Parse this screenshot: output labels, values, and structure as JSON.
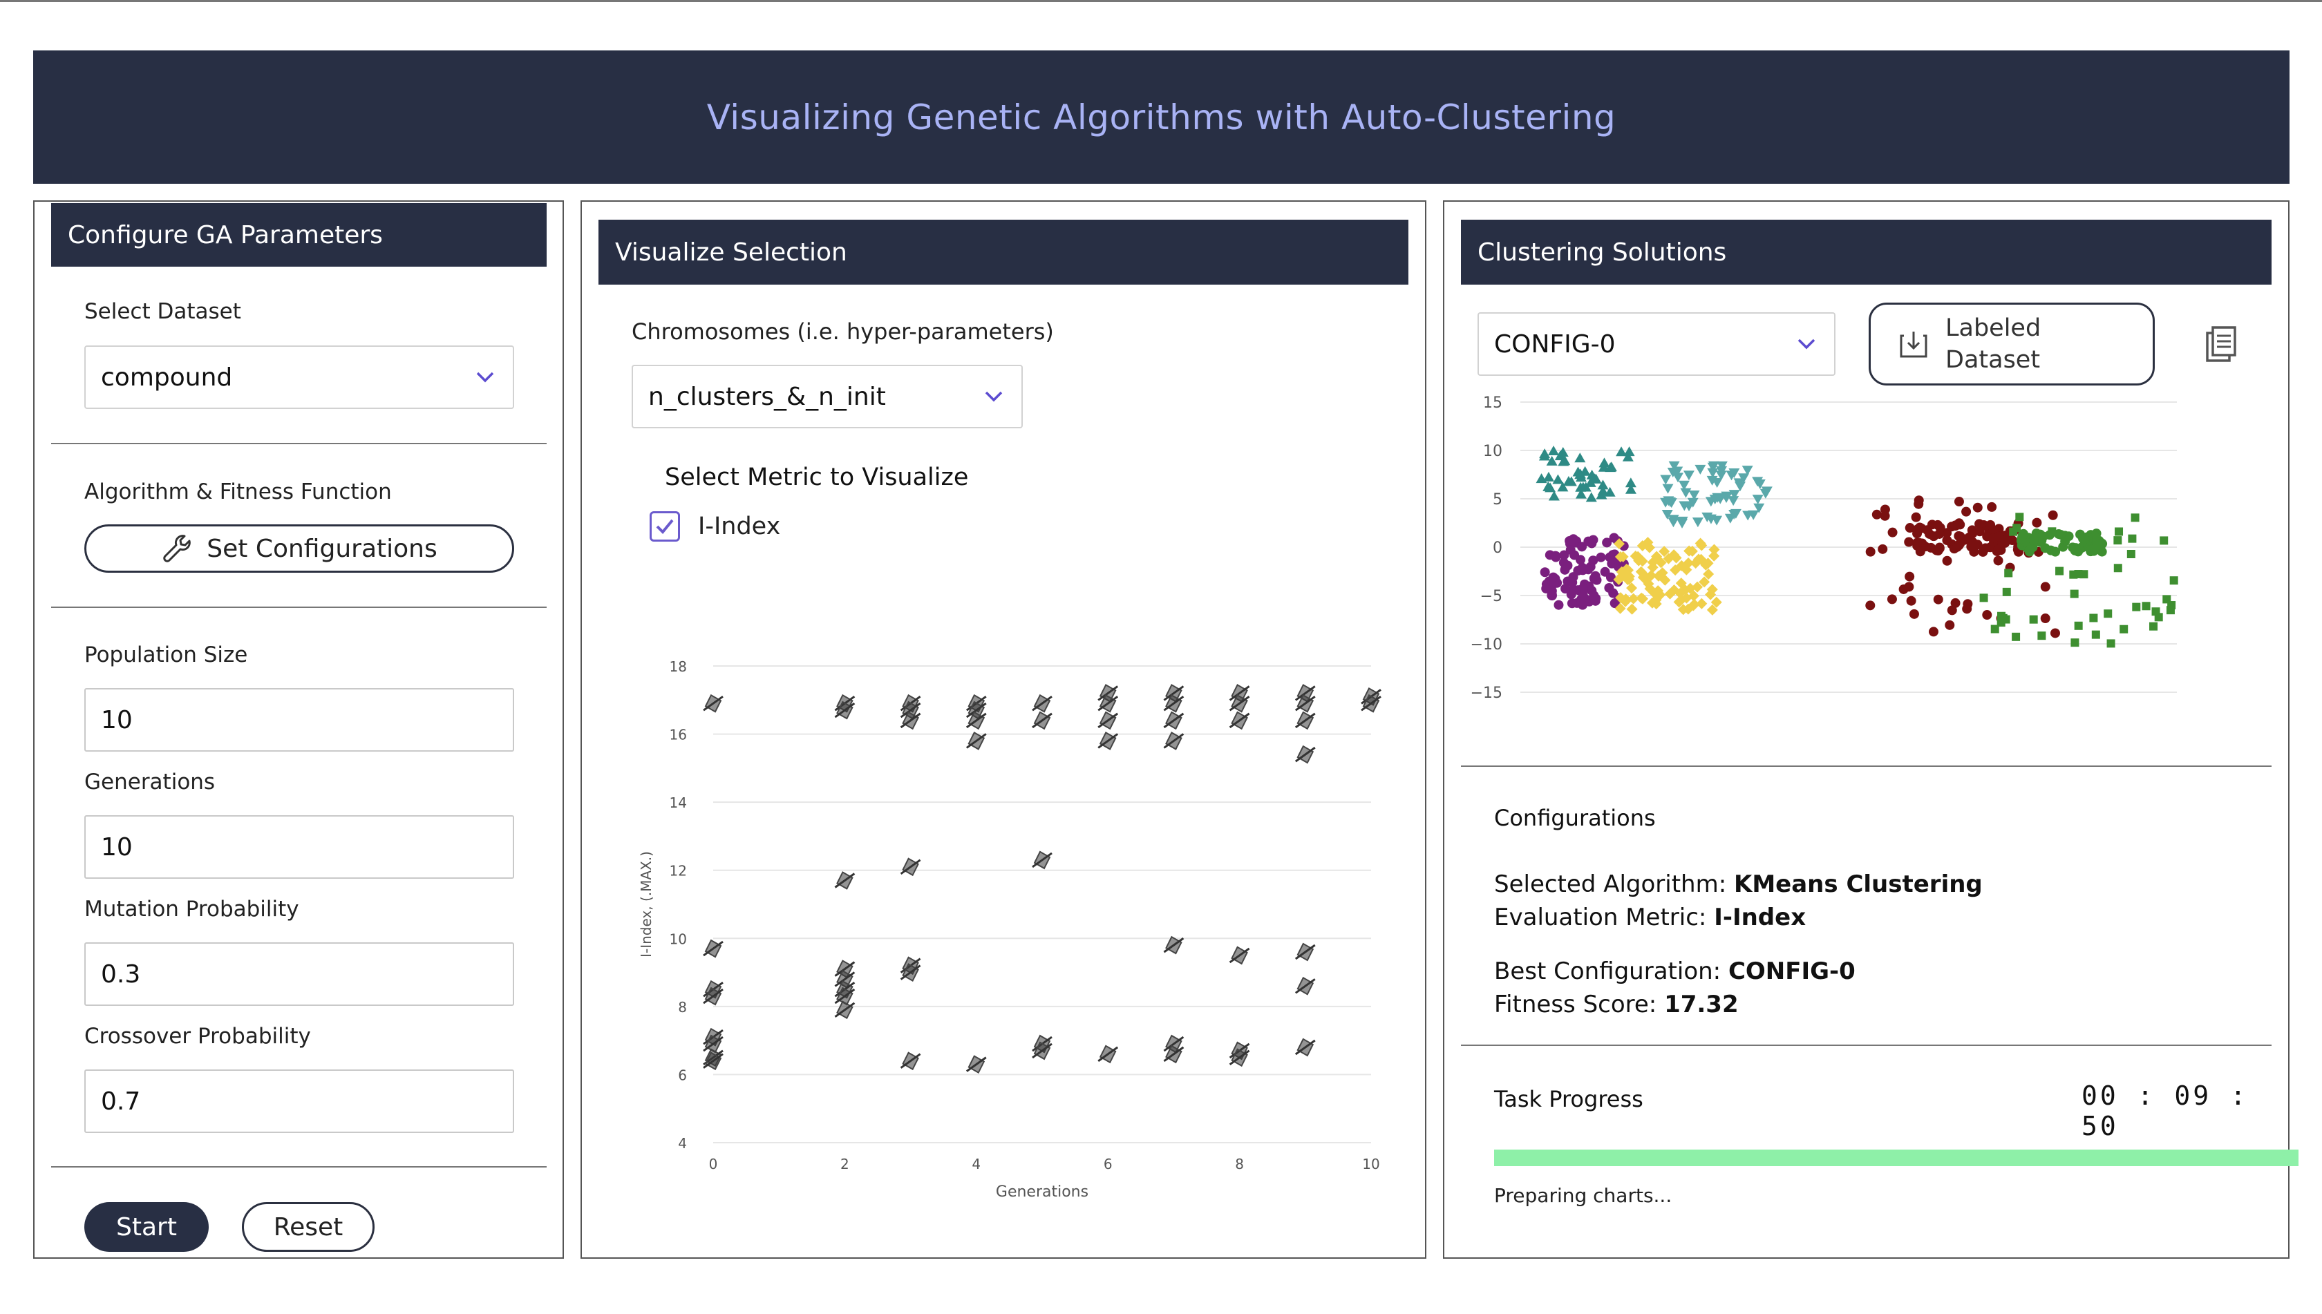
{
  "header": {
    "title": "Visualizing Genetic Algorithms with Auto-Clustering"
  },
  "left": {
    "title": "Configure GA Parameters",
    "dataset_label": "Select Dataset",
    "dataset_value": "compound",
    "algo_label": "Algorithm & Fitness Function",
    "set_config_label": "Set Configurations",
    "population_label": "Population Size",
    "population_value": "10",
    "generations_label": "Generations",
    "generations_value": "10",
    "mutation_label": "Mutation Probability",
    "mutation_value": "0.3",
    "crossover_label": "Crossover Probability",
    "crossover_value": "0.7",
    "start_label": "Start",
    "reset_label": "Reset"
  },
  "middle": {
    "title": "Visualize Selection",
    "chromosome_label": "Chromosomes (i.e. hyper-parameters)",
    "chromosome_value": "n_clusters_&_n_init",
    "metric_label": "Select Metric to Visualize",
    "metric_option": "I-Index",
    "metric_checked": true
  },
  "right": {
    "title": "Clustering Solutions",
    "config_value": "CONFIG-0",
    "labeled_line1": "Labeled",
    "labeled_line2": "Dataset",
    "configs_title": "Configurations",
    "algo_key": "Selected Algorithm:",
    "algo_val": "KMeans Clustering",
    "metric_key": "Evaluation Metric:",
    "metric_val": "I-Index",
    "best_key": "Best Configuration:",
    "best_val": "CONFIG-0",
    "fitness_key": "Fitness Score:",
    "fitness_val": "17.32",
    "progress_title": "Task Progress",
    "timer": "00 : 09 : 50",
    "progress_fraction": 1.0,
    "progress_color": "#8ef0a8",
    "status": "Preparing charts..."
  },
  "chart_data": [
    {
      "type": "scatter",
      "title": "",
      "xlabel": "Generations",
      "ylabel": "I-Index, (.MAX.)",
      "xlim": [
        0,
        10
      ],
      "ylim": [
        4,
        18
      ],
      "xticks": [
        "0",
        "2",
        "4",
        "6",
        "8",
        "10"
      ],
      "yticks": [
        "4",
        "6",
        "8",
        "10",
        "12",
        "14",
        "16",
        "18"
      ],
      "grid": true,
      "points": [
        [
          0,
          16.9
        ],
        [
          0,
          9.7
        ],
        [
          0,
          8.5
        ],
        [
          0,
          8.3
        ],
        [
          0,
          7.1
        ],
        [
          0,
          6.9
        ],
        [
          0,
          6.5
        ],
        [
          0,
          6.4
        ],
        [
          2,
          16.9
        ],
        [
          2,
          16.7
        ],
        [
          2,
          11.7
        ],
        [
          2,
          9.1
        ],
        [
          2,
          8.8
        ],
        [
          2,
          8.5
        ],
        [
          2,
          8.3
        ],
        [
          2,
          7.9
        ],
        [
          3,
          16.9
        ],
        [
          3,
          16.7
        ],
        [
          3,
          16.4
        ],
        [
          3,
          12.1
        ],
        [
          3,
          9.2
        ],
        [
          3,
          9.0
        ],
        [
          3,
          6.4
        ],
        [
          4,
          16.9
        ],
        [
          4,
          16.7
        ],
        [
          4,
          16.4
        ],
        [
          4,
          15.8
        ],
        [
          4,
          6.3
        ],
        [
          5,
          16.9
        ],
        [
          5,
          16.4
        ],
        [
          5,
          12.3
        ],
        [
          5,
          6.9
        ],
        [
          5,
          6.7
        ],
        [
          6,
          17.2
        ],
        [
          6,
          16.9
        ],
        [
          6,
          16.4
        ],
        [
          6,
          15.8
        ],
        [
          6,
          6.6
        ],
        [
          7,
          17.2
        ],
        [
          7,
          16.9
        ],
        [
          7,
          16.4
        ],
        [
          7,
          15.8
        ],
        [
          7,
          9.8
        ],
        [
          7,
          6.9
        ],
        [
          7,
          6.6
        ],
        [
          8,
          17.2
        ],
        [
          8,
          16.9
        ],
        [
          8,
          16.4
        ],
        [
          8,
          9.5
        ],
        [
          8,
          6.7
        ],
        [
          8,
          6.5
        ],
        [
          9,
          17.2
        ],
        [
          9,
          16.9
        ],
        [
          9,
          16.4
        ],
        [
          9,
          15.4
        ],
        [
          9,
          9.6
        ],
        [
          9,
          8.6
        ],
        [
          9,
          6.8
        ],
        [
          10,
          17.1
        ],
        [
          10,
          16.9
        ]
      ]
    },
    {
      "type": "scatter",
      "title": "",
      "xlabel": "",
      "ylabel": "",
      "yticks": [
        "15",
        "10",
        "5",
        "0",
        "−5",
        "−10",
        "−15"
      ],
      "ylim": [
        -15,
        15
      ],
      "xlim": [
        0,
        40
      ],
      "grid": true,
      "series": [
        {
          "marker": "triangle-up",
          "color": "#2e8a85",
          "center": [
            4,
            7.5
          ],
          "spread": [
            3,
            2.5
          ],
          "n": 45
        },
        {
          "marker": "triangle-down",
          "color": "#5aa8aa",
          "center": [
            12,
            5.5
          ],
          "spread": [
            3.2,
            3
          ],
          "n": 60
        },
        {
          "marker": "circle",
          "color": "#7a1f7e",
          "center": [
            4,
            -2.5
          ],
          "spread": [
            2.5,
            3.5
          ],
          "n": 90
        },
        {
          "marker": "diamond",
          "color": "#f0cf4a",
          "center": [
            9,
            -3
          ],
          "spread": [
            3,
            3.5
          ],
          "n": 90
        },
        {
          "marker": "circle",
          "color": "#7a1010",
          "center": [
            27,
            1
          ],
          "spread": [
            3.5,
            1.5
          ],
          "n": 80
        },
        {
          "marker": "circle",
          "color": "#7a1010",
          "center": [
            27,
            -2
          ],
          "spread": [
            6,
            7
          ],
          "n": 45
        },
        {
          "marker": "circle",
          "color": "#3e8f30",
          "center": [
            33,
            0.5
          ],
          "spread": [
            2.5,
            1
          ],
          "n": 60
        },
        {
          "marker": "square",
          "color": "#3e8f30",
          "center": [
            34,
            -3
          ],
          "spread": [
            6,
            7
          ],
          "n": 45
        }
      ]
    }
  ]
}
